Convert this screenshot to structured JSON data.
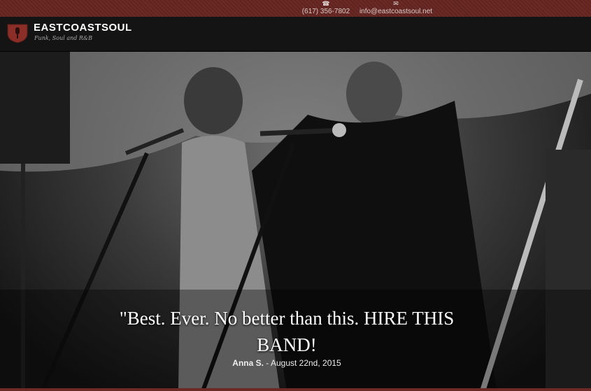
{
  "contact": {
    "phone": "(617) 356-7802",
    "email": "info@eastcoastsoul.net",
    "phone_icon": "phone-icon",
    "email_icon": "envelope-icon"
  },
  "brand": {
    "name": "EASTCOASTSOUL",
    "tagline": "Funk, Soul and R&B",
    "logo_icon": "shield-logo-icon"
  },
  "testimonial": {
    "quote": "\"Best. Ever. No better than this. HIRE THIS BAND!",
    "author": "Anna S.",
    "date": "- August 22nd, 2015"
  },
  "colors": {
    "topbar": "#6b2a26",
    "header": "#141414",
    "accent": "#8b2e28"
  }
}
